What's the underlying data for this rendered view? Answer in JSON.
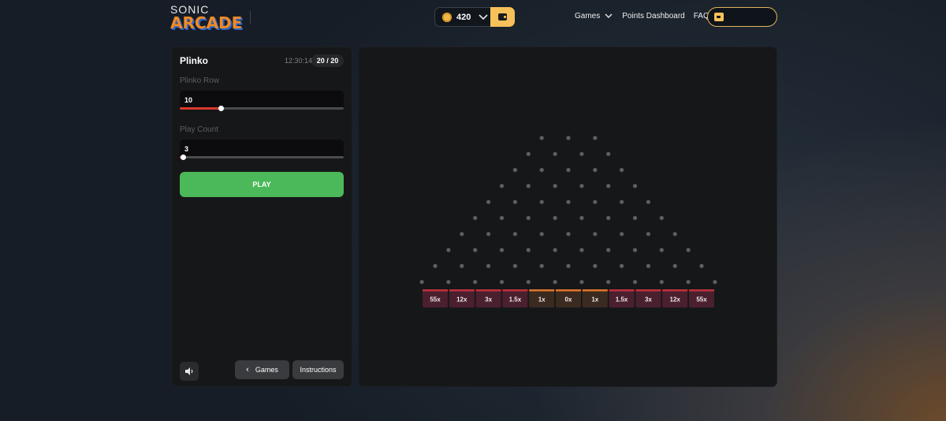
{
  "header": {
    "logo_top": "SONIC",
    "logo_bottom": "ARCADE",
    "coins": "420",
    "nav": {
      "games": "Games",
      "points_dashboard": "Points Dashboard",
      "faq": "FAQ"
    }
  },
  "game": {
    "title": "Plinko",
    "time": "12:30:14",
    "counter": "20 / 20",
    "plinko_row": {
      "label": "Plinko Row",
      "value": "10",
      "min": 8,
      "max": 16
    },
    "play_count": {
      "label": "Play Count",
      "value": "3",
      "min": 1,
      "max": 100
    },
    "play_label": "PLAY",
    "games_label": "Games",
    "instructions_label": "Instructions"
  },
  "board": {
    "rows": 10,
    "multipliers": [
      "55x",
      "12x",
      "3x",
      "1.5x",
      "1x",
      "0x",
      "1x",
      "1.5x",
      "3x",
      "12x",
      "55x"
    ],
    "colors": {
      "peg": "#5d5f66",
      "slot_high": "#4a1f2e",
      "slot_low": "#3a2a1f",
      "border_high": "#c0303c",
      "border_low": "#e0762a"
    }
  }
}
